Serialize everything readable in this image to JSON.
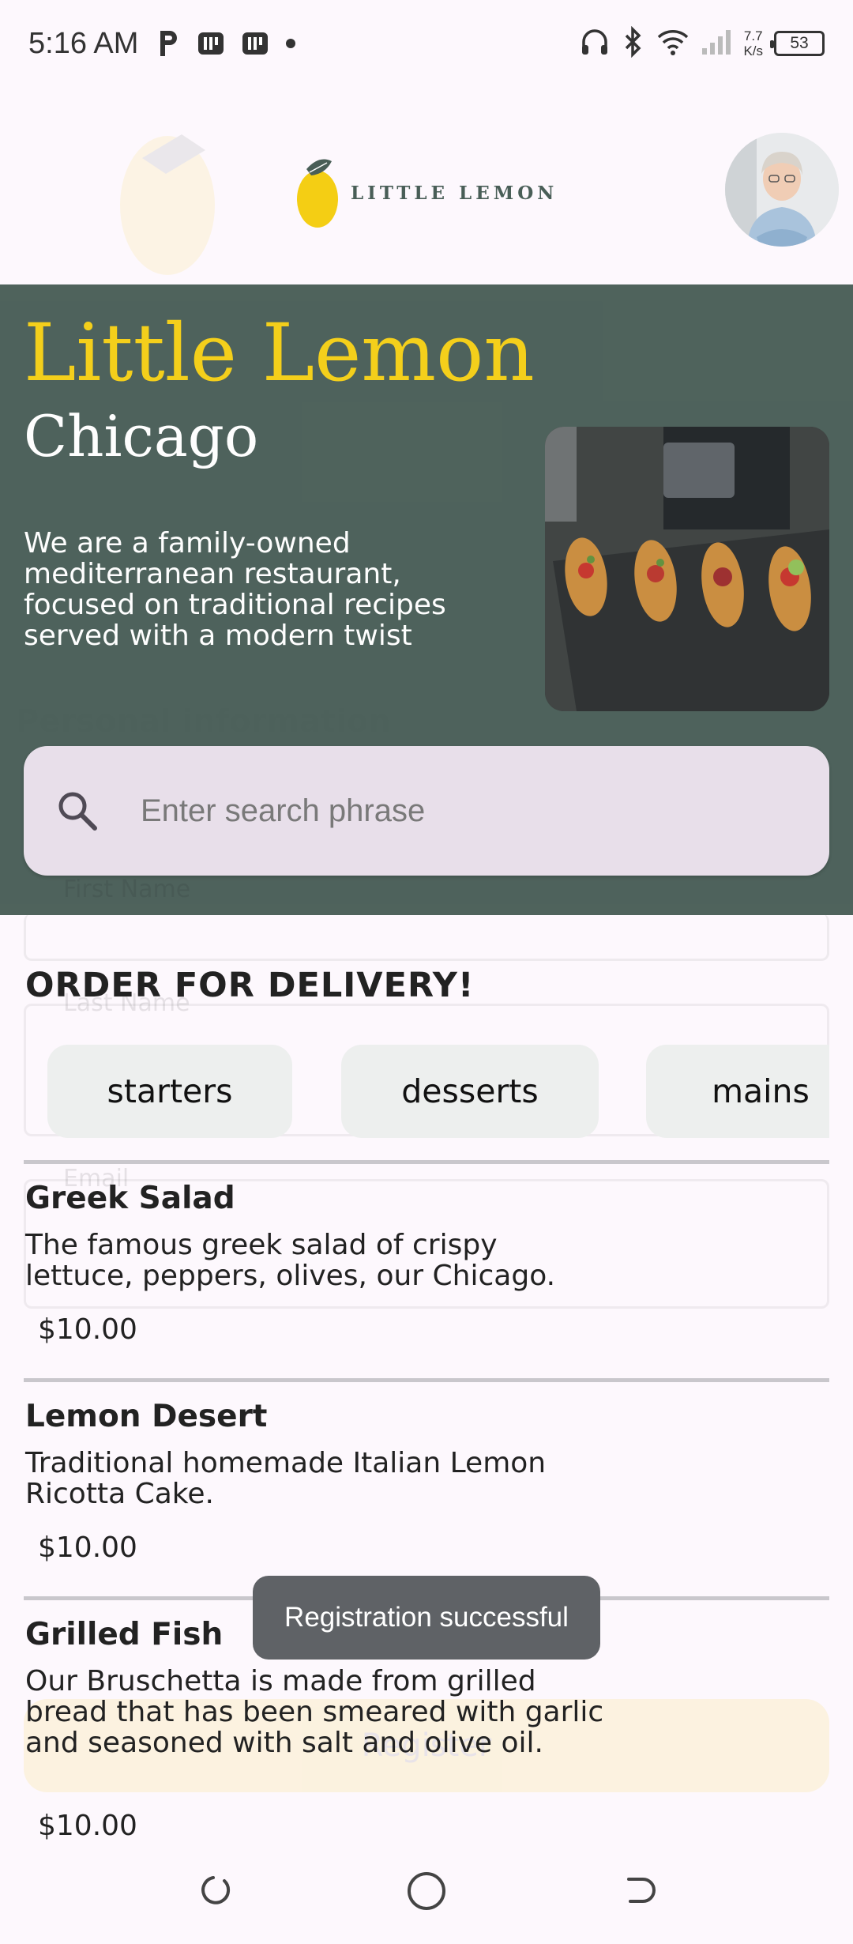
{
  "status_bar": {
    "time": "5:16 AM",
    "net_speed_value": "7.7",
    "net_speed_unit": "K/s",
    "battery": "53"
  },
  "header": {
    "logo_text": "LITTLE LEMON",
    "avatar_icon": "profile-avatar"
  },
  "hero": {
    "title": "Little Lemon",
    "city": "Chicago",
    "description": "We are a family-owned mediterranean restaurant, focused on traditional recipes served with a modern twist",
    "search_placeholder": "Enter search phrase"
  },
  "order": {
    "title": "ORDER FOR DELIVERY!",
    "categories": [
      "starters",
      "desserts",
      "mains"
    ]
  },
  "menu": [
    {
      "name": "Greek Salad",
      "description": "The famous greek salad of crispy lettuce, peppers, olives, our Chicago.",
      "price": "$10.00"
    },
    {
      "name": "Lemon Desert",
      "description": "Traditional homemade Italian Lemon Ricotta Cake.",
      "price": "$10.00"
    },
    {
      "name": "Grilled Fish",
      "description": "Our Bruschetta is made from grilled bread that has been smeared with garlic and seasoned with salt and olive oil.",
      "price": "$10.00"
    }
  ],
  "background_form": {
    "section_title": "Personal information",
    "first_name_label": "First Name",
    "last_name_label": "Last Name",
    "email_label": "Email",
    "register_label": "Register"
  },
  "toast": "Registration successful",
  "colors": {
    "primary_green": "#495e57",
    "primary_yellow": "#f4ce14",
    "search_bg": "#e8dfea",
    "chip_bg": "#edefee",
    "page_bg": "#fdf8fd"
  }
}
